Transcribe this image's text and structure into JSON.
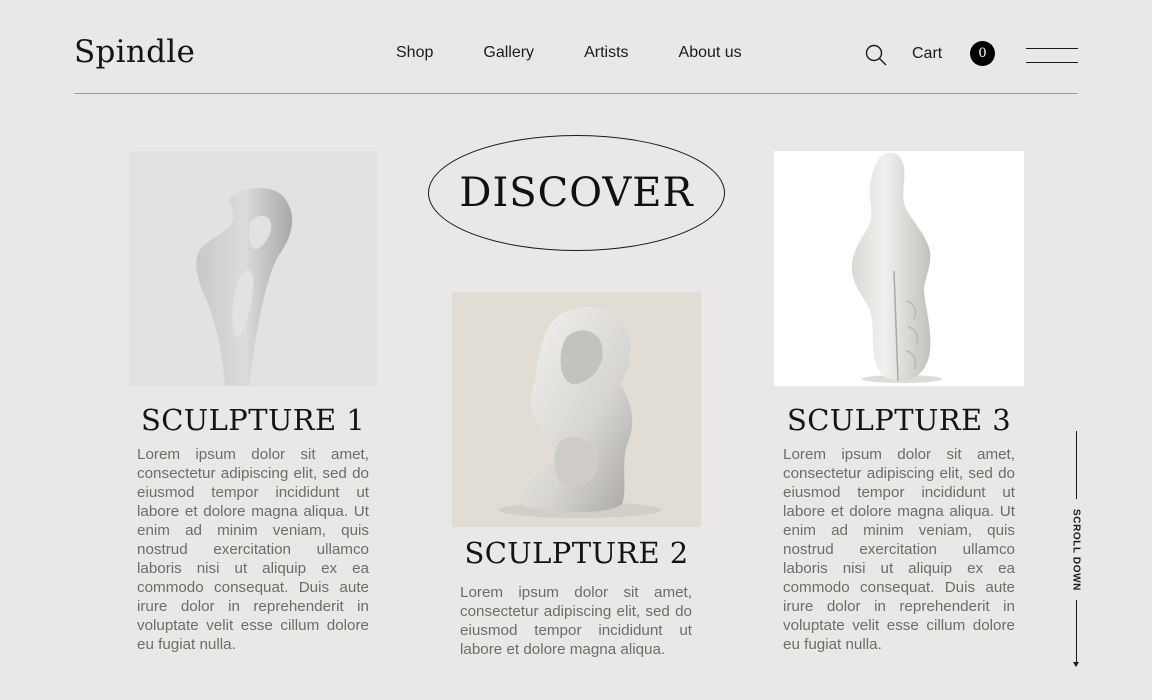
{
  "brand": {
    "name": "Spindle"
  },
  "nav": {
    "items": [
      {
        "label": "Shop"
      },
      {
        "label": "Gallery"
      },
      {
        "label": "Artists"
      },
      {
        "label": "About us"
      }
    ]
  },
  "header": {
    "search_icon": "search-icon",
    "cart_label": "Cart",
    "cart_count": "0",
    "menu_icon": "hamburger-menu-icon"
  },
  "hero": {
    "discover_label": "DISCOVER"
  },
  "sculptures": [
    {
      "title": "SCULPTURE 1",
      "description": "Lorem ipsum dolor sit amet, consectetur adipiscing elit, sed do eiusmod tempor incididunt ut labore et dolore magna aliqua. Ut enim ad minim veniam, quis nostrud exercitation ullamco laboris nisi ut aliquip ex ea commodo consequat. Duis aute irure dolor in reprehenderit in voluptate velit esse cillum dolore eu fugiat nulla."
    },
    {
      "title": "SCULPTURE 2",
      "description": "Lorem ipsum dolor sit amet, consectetur adipiscing elit, sed do eiusmod tempor incididunt ut labore et dolore magna aliqua."
    },
    {
      "title": "SCULPTURE 3",
      "description": "Lorem ipsum dolor sit amet, consectetur adipiscing elit, sed do eiusmod tempor incididunt ut labore et dolore magna aliqua. Ut enim ad minim veniam, quis nostrud exercitation ullamco laboris nisi ut aliquip ex ea commodo consequat. Duis aute irure dolor in reprehenderit in voluptate velit esse cillum dolore eu fugiat nulla."
    }
  ],
  "scroll": {
    "label": "SCROLL DOWN"
  },
  "colors": {
    "background": "#eae8e6",
    "text": "#1a1a1a",
    "muted_text": "#6e6c69",
    "badge": "#000000"
  }
}
